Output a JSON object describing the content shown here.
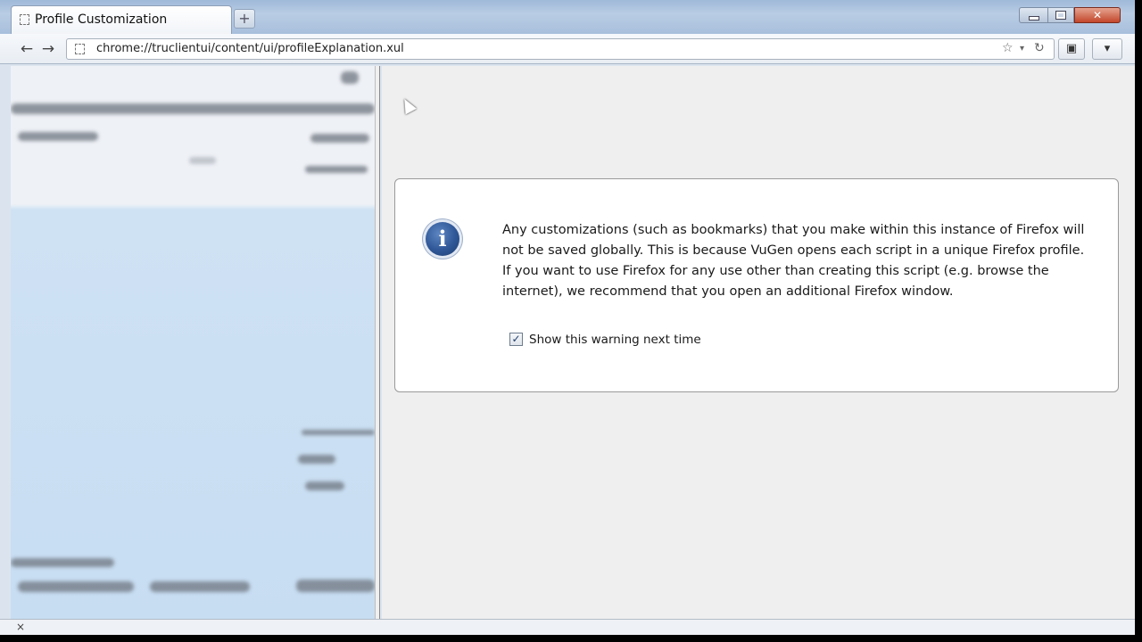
{
  "tab": {
    "title": "Profile Customization",
    "new_tab_symbol": "+"
  },
  "window_controls": {
    "minimize_icon": "minimize-icon",
    "maximize_icon": "maximize-icon",
    "close_icon": "close-icon"
  },
  "toolbar": {
    "back_symbol": "←",
    "forward_symbol": "→",
    "url": "chrome://truclientui/content/ui/profileExplanation.xul",
    "bookmark_symbol": "☆",
    "dropdown_symbol": "▾",
    "reload_symbol": "↻",
    "addon_symbol": "▣",
    "menu_symbol": "▾"
  },
  "dialog": {
    "message": "Any customizations (such as bookmarks) that you make within this instance of Firefox will not be saved globally. This is because VuGen opens each script in a unique Firefox profile. If you want to use Firefox for any use other than creating this script (e.g. browse the internet), we recommend that you open an additional Firefox window.",
    "info_glyph": "i",
    "checkbox_checked": true,
    "checkbox_mark": "✓",
    "checkbox_label": "Show this warning next time"
  },
  "statusbar": {
    "close_symbol": "×"
  },
  "colors": {
    "info_icon": "#2f5797",
    "close_button": "#c2462a",
    "titlebar": "#b9cde4"
  }
}
